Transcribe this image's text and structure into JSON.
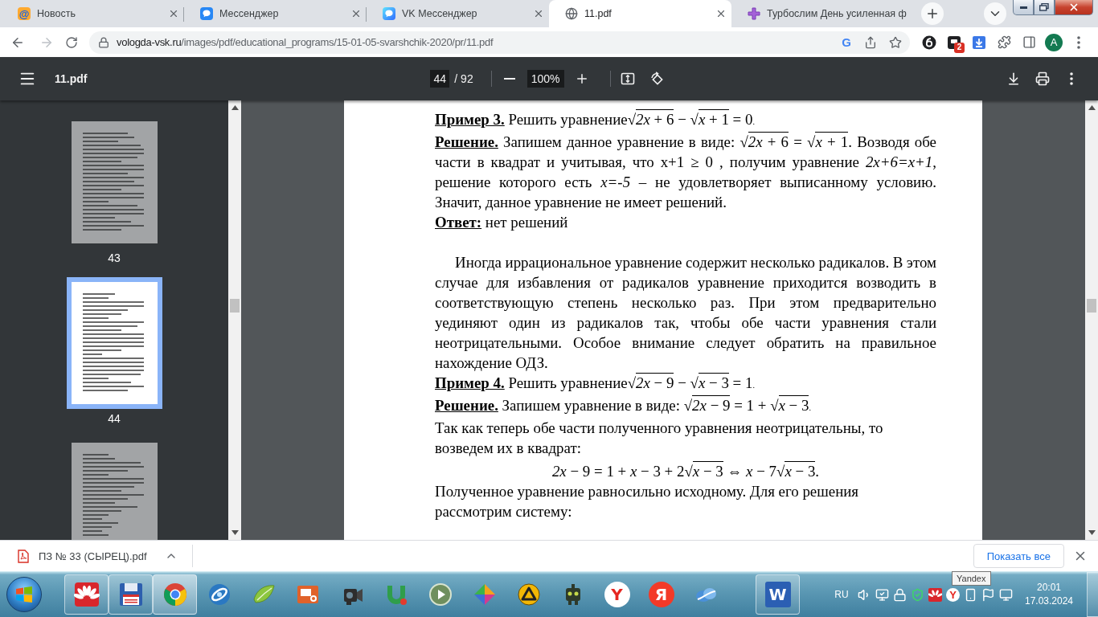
{
  "browser": {
    "tabs": [
      {
        "title": "Новость",
        "kind": "mail",
        "glyph": "@",
        "selected": false,
        "close_button": true
      },
      {
        "title": "Мессенджер",
        "kind": "bubble",
        "selected": false,
        "close_button": true
      },
      {
        "title": "VK Мессенджер",
        "kind": "vk",
        "selected": false,
        "close_button": true
      },
      {
        "title": "11.pdf",
        "kind": "globe",
        "selected": true,
        "close_button": true
      },
      {
        "title": "Турбослим День усиленная ф",
        "kind": "cross",
        "selected": false,
        "close_button": false
      }
    ],
    "forward_disabled": true,
    "address": {
      "host": "vologda-vsk.ru",
      "path": "/images/pdf/educational_programs/15-01-05-svarshchik-2020/pr/11.pdf",
      "engine_letter": "G"
    },
    "extension_badge": "2",
    "profile_initial": "A"
  },
  "toolbar": {
    "title": "11.pdf",
    "page": "44",
    "page_count": "/ 92",
    "zoom": "100%"
  },
  "sidebar": {
    "thumbnails": [
      {
        "label": "43",
        "selected": false
      },
      {
        "label": "44",
        "selected": true
      },
      {
        "selected": false
      }
    ]
  },
  "document": {
    "blocks": [
      {
        "runs": [
          {
            "kind": "label",
            "text": "Пример 3."
          },
          {
            "kind": "text",
            "text": " Решить уравнение"
          },
          {
            "kind": "root",
            "sign": "√",
            "text": "*2x* + 6"
          },
          {
            "kind": "text",
            "text": " − "
          },
          {
            "kind": "root",
            "sign": "√",
            "text": "*x* + 1"
          },
          {
            "kind": "text",
            "text": " = 0"
          },
          {
            "kind": "small",
            "text": "."
          }
        ]
      },
      {
        "justified": true,
        "runs": [
          {
            "kind": "label",
            "text": "Решение."
          },
          {
            "kind": "text",
            "text": " Запишем данное уравнение в виде: "
          },
          {
            "kind": "root",
            "sign": "√",
            "text": "*2x* + 6"
          },
          {
            "kind": "text",
            "text": " = "
          },
          {
            "kind": "root",
            "sign": "√",
            "text": "*x* + 1"
          },
          {
            "kind": "text",
            "text": ". Возводя обе части в квадрат и учитывая, что x+1 ≥ 0 , получим уравнение *2x+6=x+1*, решение которого есть *x=-5* – не удовлетворяет выписанному условию. Значит, данное уравнение не имеет решений."
          }
        ]
      },
      {
        "runs": [
          {
            "kind": "label",
            "text": "Ответ:"
          },
          {
            "kind": "text",
            "text": " нет решений"
          }
        ]
      },
      {
        "justified": true,
        "indent": true,
        "space_before": true,
        "lines": [
          "Иногда иррациональное уравнение содержит несколько радикалов. В этом",
          "случае для избавления от радикалов уравнение приходится возводить в",
          "соответствующую степень несколько раз. При этом предварительно",
          "уединяют один из радикалов так, чтобы обе части уравнения стали",
          "неотрицательными. Особое внимание следует обратить на правильное",
          "нахождение ОДЗ."
        ]
      },
      {
        "runs": [
          {
            "kind": "label",
            "text": "Пример 4."
          },
          {
            "kind": "text",
            "text": " Решить уравнение"
          },
          {
            "kind": "root",
            "sign": "√",
            "text": "*2x* − 9"
          },
          {
            "kind": "text",
            "text": " − "
          },
          {
            "kind": "root",
            "sign": "√",
            "text": "*x* − 3"
          },
          {
            "kind": "text",
            "text": " = 1"
          },
          {
            "kind": "small",
            "text": "."
          }
        ]
      },
      {
        "runs": [
          {
            "kind": "label",
            "text": "Решение."
          },
          {
            "kind": "text",
            "text": " Запишем уравнение в виде: "
          },
          {
            "kind": "root",
            "sign": "√",
            "text": "*2x* − 9"
          },
          {
            "kind": "text",
            "text": " = 1 + "
          },
          {
            "kind": "root",
            "sign": "√",
            "text": "*x* − 3"
          },
          {
            "kind": "small",
            "text": "."
          }
        ]
      },
      {
        "narrow": true,
        "runs": [
          {
            "kind": "text",
            "text": "Так как теперь обе части полученного уравнения неотрицательны, то возведем их в квадрат:"
          }
        ]
      },
      {
        "centered": true,
        "runs": [
          {
            "kind": "text",
            "text": "*2x* − 9 = 1 + *x* − 3 + 2"
          },
          {
            "kind": "root",
            "sign": "√",
            "text": "*x* − 3"
          },
          {
            "kind": "text",
            "text": " ⇔ *x* − 7"
          },
          {
            "kind": "root",
            "sign": "√",
            "text": "*x* − 3"
          },
          {
            "kind": "text",
            "text": "."
          }
        ]
      },
      {
        "narrow": true,
        "runs": [
          {
            "kind": "text",
            "text": "Полученное уравнение равносильно исходному. Для его решения рассмотрим систему:"
          }
        ]
      }
    ]
  },
  "downloads": {
    "file": "ПЗ № 33 (СЫРЕЦ).pdf",
    "show_all": "Показать все"
  },
  "taskbar": {
    "apps": [
      {
        "kind": "flower",
        "running": true,
        "active": false
      },
      {
        "kind": "floppy",
        "running": true,
        "active": false
      },
      {
        "kind": "browser",
        "running": true,
        "active": true
      },
      {
        "kind": "orb",
        "running": false,
        "active": false
      },
      {
        "kind": "leaf",
        "running": false,
        "active": false
      },
      {
        "kind": "slides",
        "running": false,
        "active": false
      },
      {
        "kind": "camcorder",
        "running": false,
        "active": false
      },
      {
        "kind": "magnet",
        "running": false,
        "active": false
      },
      {
        "kind": "play",
        "running": false,
        "active": false
      },
      {
        "kind": "cube",
        "running": false,
        "active": false
      },
      {
        "kind": "triangle",
        "running": false,
        "active": false
      },
      {
        "kind": "robot",
        "running": false,
        "active": false
      },
      {
        "kind": "ylogo",
        "glyph": "Y",
        "running": false,
        "active": false
      },
      {
        "kind": "yletter",
        "glyph": "Я",
        "running": false,
        "active": false
      },
      {
        "kind": "cloud",
        "running": false,
        "active": false
      },
      {
        "kind": "word",
        "glyph": "W",
        "running": true,
        "active": false
      }
    ],
    "tray": {
      "language": "RU",
      "logo_letter": "Y",
      "time": "20:01",
      "date": "17.03.2024"
    },
    "tooltip": "Yandex"
  }
}
